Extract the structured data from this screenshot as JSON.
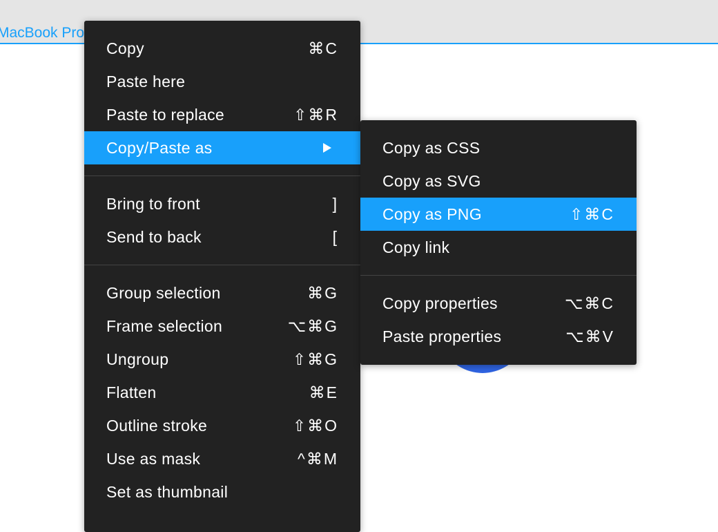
{
  "topbar": {
    "frame_label": "MacBook Pro"
  },
  "context_menu": {
    "group1": [
      {
        "label": "Copy",
        "shortcut": "⌘C"
      },
      {
        "label": "Paste here",
        "shortcut": ""
      },
      {
        "label": "Paste to replace",
        "shortcut": "⇧⌘R"
      },
      {
        "label": "Copy/Paste as",
        "shortcut": "",
        "has_submenu": true,
        "active": true
      }
    ],
    "group2": [
      {
        "label": "Bring to front",
        "shortcut": "]"
      },
      {
        "label": "Send to back",
        "shortcut": "["
      }
    ],
    "group3": [
      {
        "label": "Group selection",
        "shortcut": "⌘G"
      },
      {
        "label": "Frame selection",
        "shortcut": "⌥⌘G"
      },
      {
        "label": "Ungroup",
        "shortcut": "⇧⌘G"
      },
      {
        "label": "Flatten",
        "shortcut": "⌘E"
      },
      {
        "label": "Outline stroke",
        "shortcut": "⇧⌘O"
      },
      {
        "label": "Use as mask",
        "shortcut": "^⌘M"
      },
      {
        "label": "Set as thumbnail",
        "shortcut": ""
      }
    ]
  },
  "submenu": {
    "group1": [
      {
        "label": "Copy as CSS",
        "shortcut": ""
      },
      {
        "label": "Copy as SVG",
        "shortcut": ""
      },
      {
        "label": "Copy as PNG",
        "shortcut": "⇧⌘C",
        "active": true
      },
      {
        "label": "Copy link",
        "shortcut": ""
      }
    ],
    "group2": [
      {
        "label": "Copy properties",
        "shortcut": "⌥⌘C"
      },
      {
        "label": "Paste properties",
        "shortcut": "⌥⌘V"
      }
    ]
  },
  "colors": {
    "accent": "#18a0fb",
    "menu_bg": "#222222",
    "shape": "#2f64e3"
  }
}
